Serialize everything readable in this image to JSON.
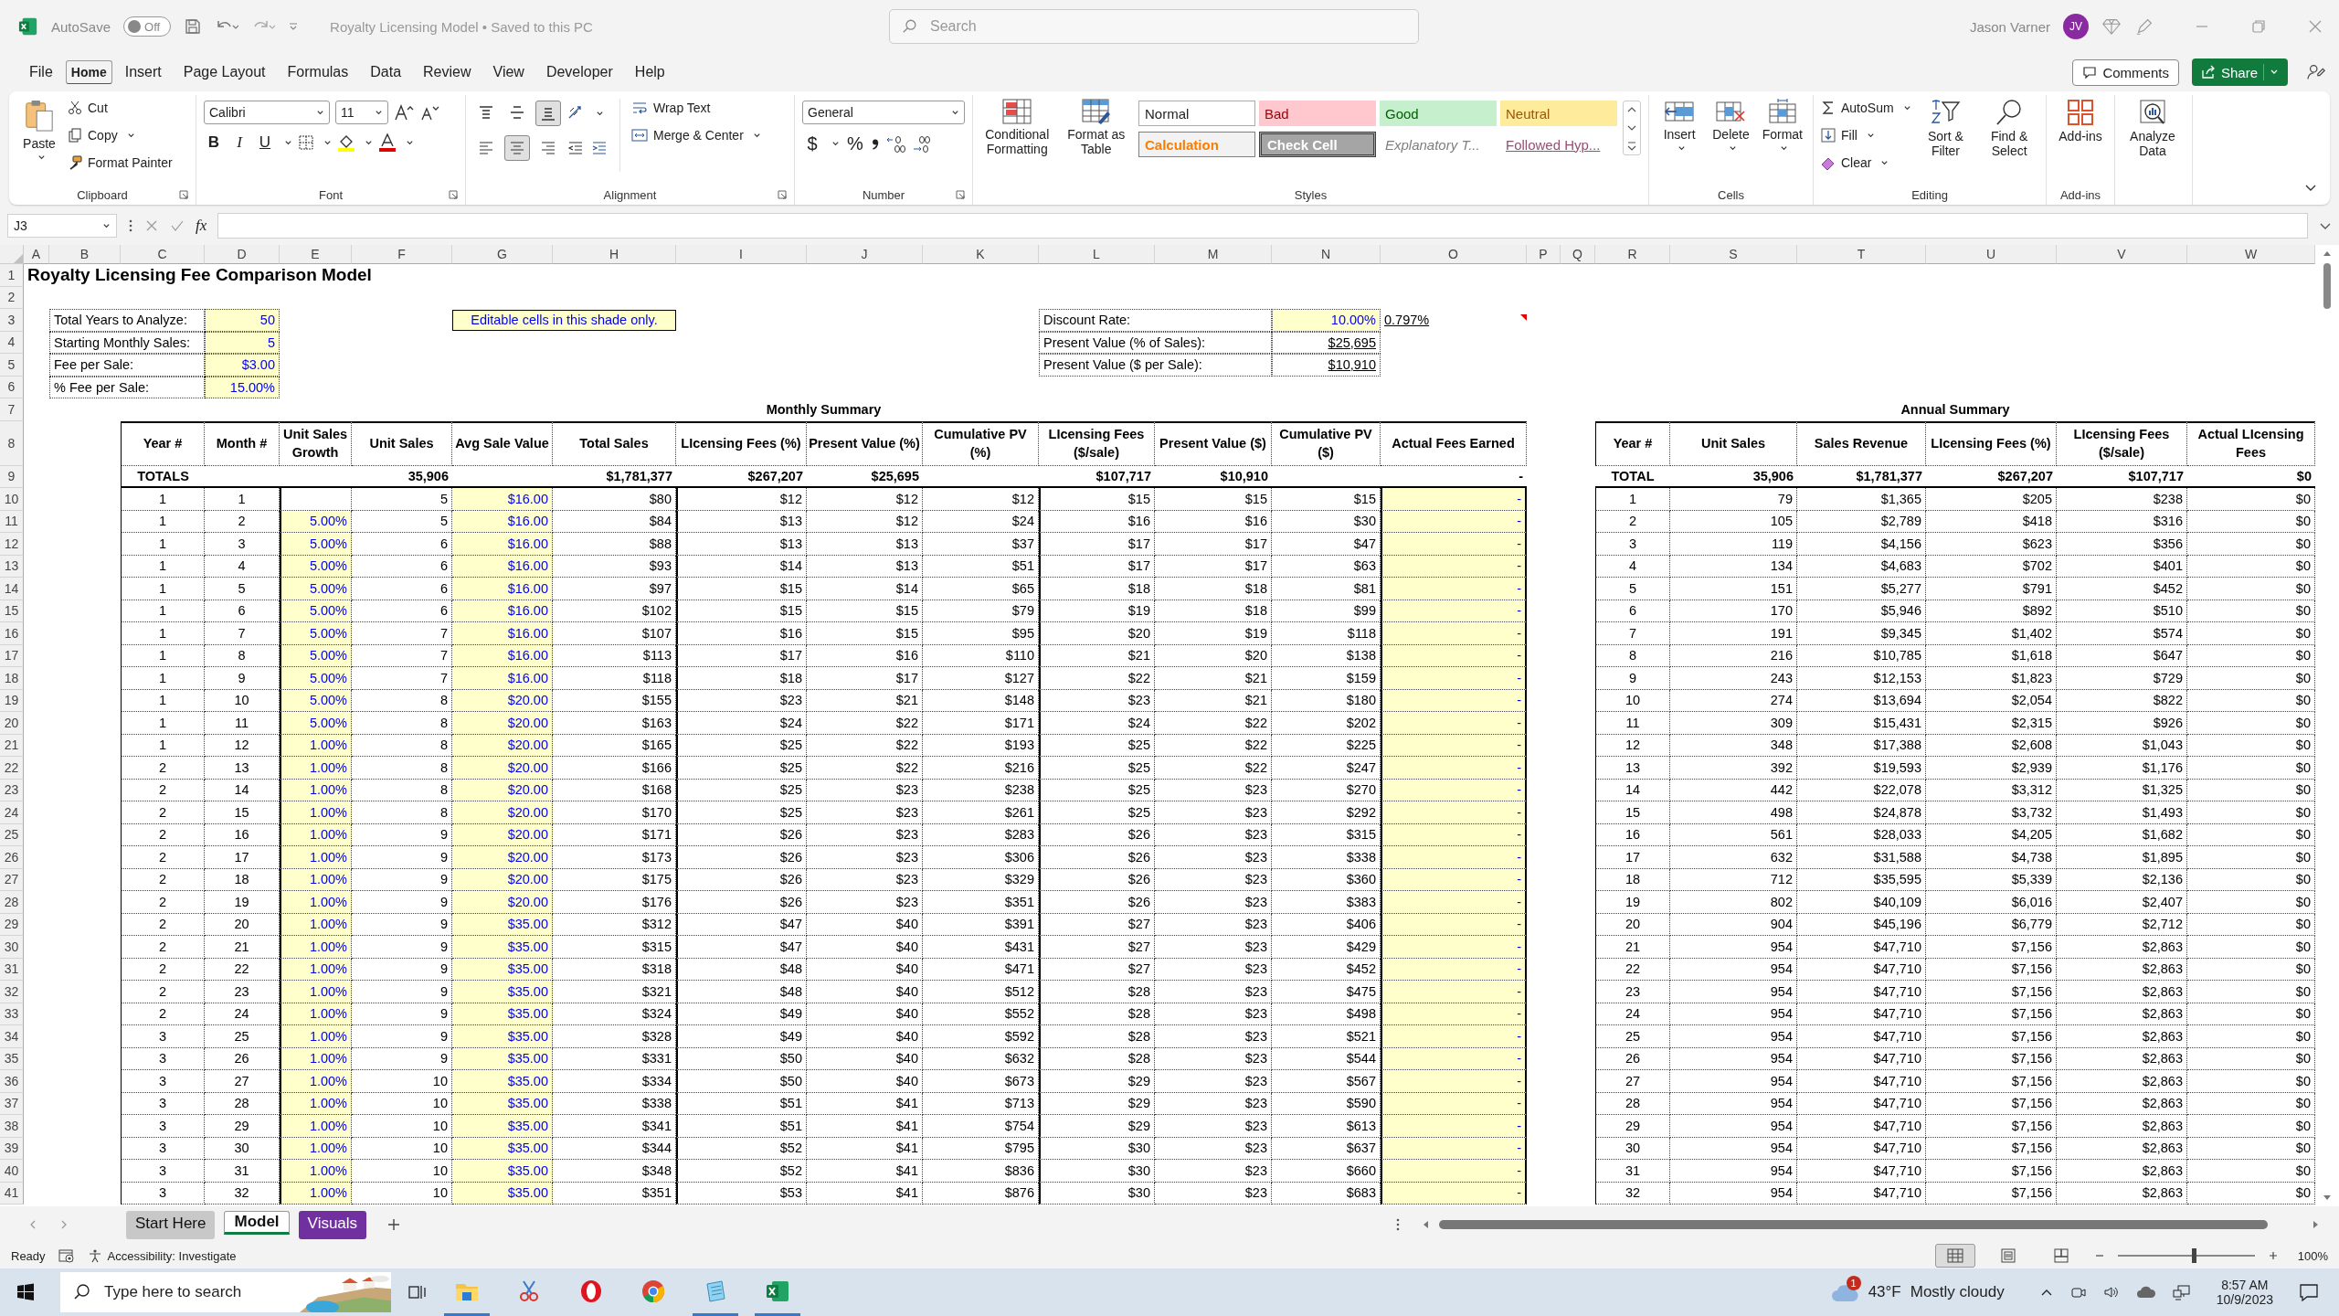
{
  "title_bar": {
    "autosave_label": "AutoSave",
    "autosave": {
      "on": false,
      "label": "Off"
    },
    "document_title": "Royalty Licensing Model • Saved to this PC",
    "search_placeholder": "Search",
    "user_name": "Jason Varner",
    "user_initials": "JV"
  },
  "menu_tabs": [
    {
      "label": "File",
      "selected": false
    },
    {
      "label": "Home",
      "selected": true
    },
    {
      "label": "Insert",
      "selected": false
    },
    {
      "label": "Page Layout",
      "selected": false
    },
    {
      "label": "Formulas",
      "selected": false
    },
    {
      "label": "Data",
      "selected": false
    },
    {
      "label": "Review",
      "selected": false
    },
    {
      "label": "View",
      "selected": false
    },
    {
      "label": "Developer",
      "selected": false
    },
    {
      "label": "Help",
      "selected": false
    }
  ],
  "comments_button": "Comments",
  "share_button": "Share",
  "ribbon": {
    "clipboard": {
      "label": "Clipboard",
      "paste": "Paste",
      "cut": "Cut",
      "copy": "Copy",
      "format_painter": "Format Painter"
    },
    "font": {
      "label": "Font",
      "font_name": "Calibri",
      "font_size": "11",
      "bold": "B",
      "italic": "I",
      "underline": "U"
    },
    "alignment": {
      "label": "Alignment",
      "vertical": [
        {
          "kind": "top",
          "selected": false
        },
        {
          "kind": "middle",
          "selected": false
        },
        {
          "kind": "bottom",
          "selected": true
        }
      ],
      "horizontal": [
        {
          "kind": "left",
          "selected": false
        },
        {
          "kind": "center",
          "selected": true
        },
        {
          "kind": "right",
          "selected": false
        }
      ],
      "wrap_text": "Wrap Text",
      "merge_center": "Merge & Center"
    },
    "number": {
      "label": "Number",
      "format": "General",
      "currency": "$",
      "percent": "%"
    },
    "styles": {
      "label": "Styles",
      "conditional_formatting": "Conditional Formatting",
      "format_as_table": "Format as Table",
      "cell_styles": [
        {
          "label": "Normal",
          "kind": "normal"
        },
        {
          "label": "Bad",
          "kind": "bad"
        },
        {
          "label": "Good",
          "kind": "good"
        },
        {
          "label": "Neutral",
          "kind": "neutral"
        },
        {
          "label": "Calculation",
          "kind": "calculation"
        },
        {
          "label": "Check Cell",
          "kind": "check"
        },
        {
          "label": "Explanatory T...",
          "kind": "explanatory"
        },
        {
          "label": "Followed Hyp...",
          "kind": "hyperlink"
        }
      ]
    },
    "cells": {
      "label": "Cells",
      "buttons": [
        {
          "label": "Insert",
          "kind": "insert"
        },
        {
          "label": "Delete",
          "kind": "delete"
        },
        {
          "label": "Format",
          "kind": "format"
        }
      ]
    },
    "editing": {
      "label": "Editing",
      "autosum": "AutoSum",
      "fill": "Fill",
      "clear": "Clear",
      "sort_filter": "Sort & Filter",
      "find_select": "Find & Select"
    },
    "add_ins": {
      "label": "Add-ins",
      "button": "Add-ins"
    },
    "analyze": {
      "button": "Analyze Data"
    }
  },
  "formula_bar": {
    "name_box": "J3",
    "fx": "fx"
  },
  "sheet": {
    "column_headers": [
      "A",
      "B",
      "C",
      "D",
      "E",
      "F",
      "G",
      "H",
      "I",
      "J",
      "K",
      "L",
      "M",
      "N",
      "O",
      "P",
      "Q",
      "R",
      "S",
      "T",
      "U",
      "V",
      "W"
    ],
    "row_numbers": [
      "1",
      "2",
      "3",
      "4",
      "5",
      "6",
      "7",
      "8",
      "9",
      "10",
      "11",
      "12",
      "13",
      "14",
      "15",
      "16",
      "17",
      "18",
      "19",
      "20",
      "21",
      "22",
      "23",
      "24",
      "25",
      "26",
      "27",
      "28",
      "29",
      "30",
      "31",
      "32",
      "33",
      "34",
      "35",
      "36",
      "37",
      "38",
      "39",
      "40",
      "41"
    ],
    "title": "Royalty Licensing Fee Comparison Model",
    "inputs": [
      {
        "label": "Total Years to Analyze:",
        "value": "50"
      },
      {
        "label": "Starting Monthly Sales:",
        "value": "5"
      },
      {
        "label": "Fee per Sale:",
        "value": "$3.00"
      },
      {
        "label": "% Fee per Sale:",
        "value": "15.00%"
      }
    ],
    "note": "Editable cells in this shade only.",
    "rates": [
      {
        "label": "Discount Rate:",
        "value": "10.00%",
        "editable": true
      },
      {
        "label": "Present Value (% of Sales):",
        "value": "$25,695",
        "editable": false
      },
      {
        "label": "Present Value ($ per Sale):",
        "value": "$10,910",
        "editable": false
      }
    ],
    "monthly_rate": "0.797%",
    "monthly_summary": {
      "title": "Monthly Summary",
      "columns": [
        "Year #",
        "Month #",
        "Unit Sales Growth",
        "Unit Sales",
        "Avg Sale Value",
        "Total Sales",
        "LIcensing Fees (%)",
        "Present Value (%)",
        "Cumulative PV (%)",
        "LIcensing Fees ($/sale)",
        "Present Value ($)",
        "Cumulative PV ($)",
        "Actual Fees Earned"
      ],
      "totals": {
        "label": "TOTALS",
        "unit_sales": "35,906",
        "total_sales": "$1,781,377",
        "licensing_fees_pct": "$267,207",
        "present_value_pct": "$25,695",
        "licensing_fees_per_sale": "$107,717",
        "present_value_per_sale": "$10,910",
        "actual_fees_earned": "-"
      },
      "rows": [
        [
          "1",
          "1",
          null,
          "5",
          "$16.00",
          "$80",
          "$12",
          "$12",
          "$12",
          "$15",
          "$15",
          "$15",
          "-"
        ],
        [
          "1",
          "2",
          "5.00%",
          "5",
          "$16.00",
          "$84",
          "$13",
          "$12",
          "$24",
          "$16",
          "$16",
          "$30",
          "-"
        ],
        [
          "1",
          "3",
          "5.00%",
          "6",
          "$16.00",
          "$88",
          "$13",
          "$13",
          "$37",
          "$17",
          "$17",
          "$47",
          "-"
        ],
        [
          "1",
          "4",
          "5.00%",
          "6",
          "$16.00",
          "$93",
          "$14",
          "$13",
          "$51",
          "$17",
          "$17",
          "$63",
          "-"
        ],
        [
          "1",
          "5",
          "5.00%",
          "6",
          "$16.00",
          "$97",
          "$15",
          "$14",
          "$65",
          "$18",
          "$18",
          "$81",
          "-"
        ],
        [
          "1",
          "6",
          "5.00%",
          "6",
          "$16.00",
          "$102",
          "$15",
          "$15",
          "$79",
          "$19",
          "$18",
          "$99",
          "-"
        ],
        [
          "1",
          "7",
          "5.00%",
          "7",
          "$16.00",
          "$107",
          "$16",
          "$15",
          "$95",
          "$20",
          "$19",
          "$118",
          "-"
        ],
        [
          "1",
          "8",
          "5.00%",
          "7",
          "$16.00",
          "$113",
          "$17",
          "$16",
          "$110",
          "$21",
          "$20",
          "$138",
          "-"
        ],
        [
          "1",
          "9",
          "5.00%",
          "7",
          "$16.00",
          "$118",
          "$18",
          "$17",
          "$127",
          "$22",
          "$21",
          "$159",
          "-"
        ],
        [
          "1",
          "10",
          "5.00%",
          "8",
          "$20.00",
          "$155",
          "$23",
          "$21",
          "$148",
          "$23",
          "$21",
          "$180",
          "-"
        ],
        [
          "1",
          "11",
          "5.00%",
          "8",
          "$20.00",
          "$163",
          "$24",
          "$22",
          "$171",
          "$24",
          "$22",
          "$202",
          "-"
        ],
        [
          "1",
          "12",
          "1.00%",
          "8",
          "$20.00",
          "$165",
          "$25",
          "$22",
          "$193",
          "$25",
          "$22",
          "$225",
          "-"
        ],
        [
          "2",
          "13",
          "1.00%",
          "8",
          "$20.00",
          "$166",
          "$25",
          "$22",
          "$216",
          "$25",
          "$22",
          "$247",
          "-"
        ],
        [
          "2",
          "14",
          "1.00%",
          "8",
          "$20.00",
          "$168",
          "$25",
          "$23",
          "$238",
          "$25",
          "$23",
          "$270",
          "-"
        ],
        [
          "2",
          "15",
          "1.00%",
          "8",
          "$20.00",
          "$170",
          "$25",
          "$23",
          "$261",
          "$25",
          "$23",
          "$292",
          "-"
        ],
        [
          "2",
          "16",
          "1.00%",
          "9",
          "$20.00",
          "$171",
          "$26",
          "$23",
          "$283",
          "$26",
          "$23",
          "$315",
          "-"
        ],
        [
          "2",
          "17",
          "1.00%",
          "9",
          "$20.00",
          "$173",
          "$26",
          "$23",
          "$306",
          "$26",
          "$23",
          "$338",
          "-"
        ],
        [
          "2",
          "18",
          "1.00%",
          "9",
          "$20.00",
          "$175",
          "$26",
          "$23",
          "$329",
          "$26",
          "$23",
          "$360",
          "-"
        ],
        [
          "2",
          "19",
          "1.00%",
          "9",
          "$20.00",
          "$176",
          "$26",
          "$23",
          "$351",
          "$26",
          "$23",
          "$383",
          "-"
        ],
        [
          "2",
          "20",
          "1.00%",
          "9",
          "$35.00",
          "$312",
          "$47",
          "$40",
          "$391",
          "$27",
          "$23",
          "$406",
          "-"
        ],
        [
          "2",
          "21",
          "1.00%",
          "9",
          "$35.00",
          "$315",
          "$47",
          "$40",
          "$431",
          "$27",
          "$23",
          "$429",
          "-"
        ],
        [
          "2",
          "22",
          "1.00%",
          "9",
          "$35.00",
          "$318",
          "$48",
          "$40",
          "$471",
          "$27",
          "$23",
          "$452",
          "-"
        ],
        [
          "2",
          "23",
          "1.00%",
          "9",
          "$35.00",
          "$321",
          "$48",
          "$40",
          "$512",
          "$28",
          "$23",
          "$475",
          "-"
        ],
        [
          "2",
          "24",
          "1.00%",
          "9",
          "$35.00",
          "$324",
          "$49",
          "$40",
          "$552",
          "$28",
          "$23",
          "$498",
          "-"
        ],
        [
          "3",
          "25",
          "1.00%",
          "9",
          "$35.00",
          "$328",
          "$49",
          "$40",
          "$592",
          "$28",
          "$23",
          "$521",
          "-"
        ],
        [
          "3",
          "26",
          "1.00%",
          "9",
          "$35.00",
          "$331",
          "$50",
          "$40",
          "$632",
          "$28",
          "$23",
          "$544",
          "-"
        ],
        [
          "3",
          "27",
          "1.00%",
          "10",
          "$35.00",
          "$334",
          "$50",
          "$40",
          "$673",
          "$29",
          "$23",
          "$567",
          "-"
        ],
        [
          "3",
          "28",
          "1.00%",
          "10",
          "$35.00",
          "$338",
          "$51",
          "$41",
          "$713",
          "$29",
          "$23",
          "$590",
          "-"
        ],
        [
          "3",
          "29",
          "1.00%",
          "10",
          "$35.00",
          "$341",
          "$51",
          "$41",
          "$754",
          "$29",
          "$23",
          "$613",
          "-"
        ],
        [
          "3",
          "30",
          "1.00%",
          "10",
          "$35.00",
          "$344",
          "$52",
          "$41",
          "$795",
          "$30",
          "$23",
          "$637",
          "-"
        ],
        [
          "3",
          "31",
          "1.00%",
          "10",
          "$35.00",
          "$348",
          "$52",
          "$41",
          "$836",
          "$30",
          "$23",
          "$660",
          "-"
        ],
        [
          "3",
          "32",
          "1.00%",
          "10",
          "$35.00",
          "$351",
          "$53",
          "$41",
          "$876",
          "$30",
          "$23",
          "$683",
          "-"
        ]
      ]
    },
    "annual_summary": {
      "title": "Annual Summary",
      "columns": [
        "Year #",
        "Unit Sales",
        "Sales Revenue",
        "LIcensing Fees (%)",
        "LIcensing Fees ($/sale)",
        "Actual LIcensing Fees"
      ],
      "totals": {
        "label": "TOTAL",
        "unit_sales": "35,906",
        "sales_revenue": "$1,781,377",
        "licensing_fees_pct": "$267,207",
        "licensing_fees_per_sale": "$107,717",
        "actual_licensing_fees": "$0"
      },
      "rows": [
        [
          "1",
          "79",
          "$1,365",
          "$205",
          "$238",
          "$0"
        ],
        [
          "2",
          "105",
          "$2,789",
          "$418",
          "$316",
          "$0"
        ],
        [
          "3",
          "119",
          "$4,156",
          "$623",
          "$356",
          "$0"
        ],
        [
          "4",
          "134",
          "$4,683",
          "$702",
          "$401",
          "$0"
        ],
        [
          "5",
          "151",
          "$5,277",
          "$791",
          "$452",
          "$0"
        ],
        [
          "6",
          "170",
          "$5,946",
          "$892",
          "$510",
          "$0"
        ],
        [
          "7",
          "191",
          "$9,345",
          "$1,402",
          "$574",
          "$0"
        ],
        [
          "8",
          "216",
          "$10,785",
          "$1,618",
          "$647",
          "$0"
        ],
        [
          "9",
          "243",
          "$12,153",
          "$1,823",
          "$729",
          "$0"
        ],
        [
          "10",
          "274",
          "$13,694",
          "$2,054",
          "$822",
          "$0"
        ],
        [
          "11",
          "309",
          "$15,431",
          "$2,315",
          "$926",
          "$0"
        ],
        [
          "12",
          "348",
          "$17,388",
          "$2,608",
          "$1,043",
          "$0"
        ],
        [
          "13",
          "392",
          "$19,593",
          "$2,939",
          "$1,176",
          "$0"
        ],
        [
          "14",
          "442",
          "$22,078",
          "$3,312",
          "$1,325",
          "$0"
        ],
        [
          "15",
          "498",
          "$24,878",
          "$3,732",
          "$1,493",
          "$0"
        ],
        [
          "16",
          "561",
          "$28,033",
          "$4,205",
          "$1,682",
          "$0"
        ],
        [
          "17",
          "632",
          "$31,588",
          "$4,738",
          "$1,895",
          "$0"
        ],
        [
          "18",
          "712",
          "$35,595",
          "$5,339",
          "$2,136",
          "$0"
        ],
        [
          "19",
          "802",
          "$40,109",
          "$6,016",
          "$2,407",
          "$0"
        ],
        [
          "20",
          "904",
          "$45,196",
          "$6,779",
          "$2,712",
          "$0"
        ],
        [
          "21",
          "954",
          "$47,710",
          "$7,156",
          "$2,863",
          "$0"
        ],
        [
          "22",
          "954",
          "$47,710",
          "$7,156",
          "$2,863",
          "$0"
        ],
        [
          "23",
          "954",
          "$47,710",
          "$7,156",
          "$2,863",
          "$0"
        ],
        [
          "24",
          "954",
          "$47,710",
          "$7,156",
          "$2,863",
          "$0"
        ],
        [
          "25",
          "954",
          "$47,710",
          "$7,156",
          "$2,863",
          "$0"
        ],
        [
          "26",
          "954",
          "$47,710",
          "$7,156",
          "$2,863",
          "$0"
        ],
        [
          "27",
          "954",
          "$47,710",
          "$7,156",
          "$2,863",
          "$0"
        ],
        [
          "28",
          "954",
          "$47,710",
          "$7,156",
          "$2,863",
          "$0"
        ],
        [
          "29",
          "954",
          "$47,710",
          "$7,156",
          "$2,863",
          "$0"
        ],
        [
          "30",
          "954",
          "$47,710",
          "$7,156",
          "$2,863",
          "$0"
        ],
        [
          "31",
          "954",
          "$47,710",
          "$7,156",
          "$2,863",
          "$0"
        ],
        [
          "32",
          "954",
          "$47,710",
          "$7,156",
          "$2,863",
          "$0"
        ]
      ]
    }
  },
  "sheet_tabs": [
    {
      "label": "Start Here",
      "selected": false,
      "color": "#c8c8c8"
    },
    {
      "label": "Model",
      "selected": true,
      "color": "#ffffff"
    },
    {
      "label": "Visuals",
      "selected": false,
      "color": "#7030a0"
    }
  ],
  "status_bar": {
    "ready": "Ready",
    "accessibility": "Accessibility: Investigate",
    "views": [
      {
        "kind": "normal",
        "selected": true
      },
      {
        "kind": "page_layout",
        "selected": false
      },
      {
        "kind": "page_break",
        "selected": false
      }
    ],
    "zoom": {
      "level": 0.55,
      "label": "100%"
    }
  },
  "taskbar": {
    "search_placeholder": "Type here to search",
    "apps": [
      {
        "kind": "explorer",
        "running": true
      },
      {
        "kind": "snip",
        "running": false
      },
      {
        "kind": "opera",
        "running": false
      },
      {
        "kind": "chrome",
        "running": false
      },
      {
        "kind": "notepad",
        "running": true
      },
      {
        "kind": "excel",
        "running": true
      }
    ],
    "weather": {
      "badge": "1",
      "temperature": "43°F",
      "condition": "Mostly cloudy"
    },
    "time": "8:57 AM",
    "date": "10/9/2023"
  }
}
